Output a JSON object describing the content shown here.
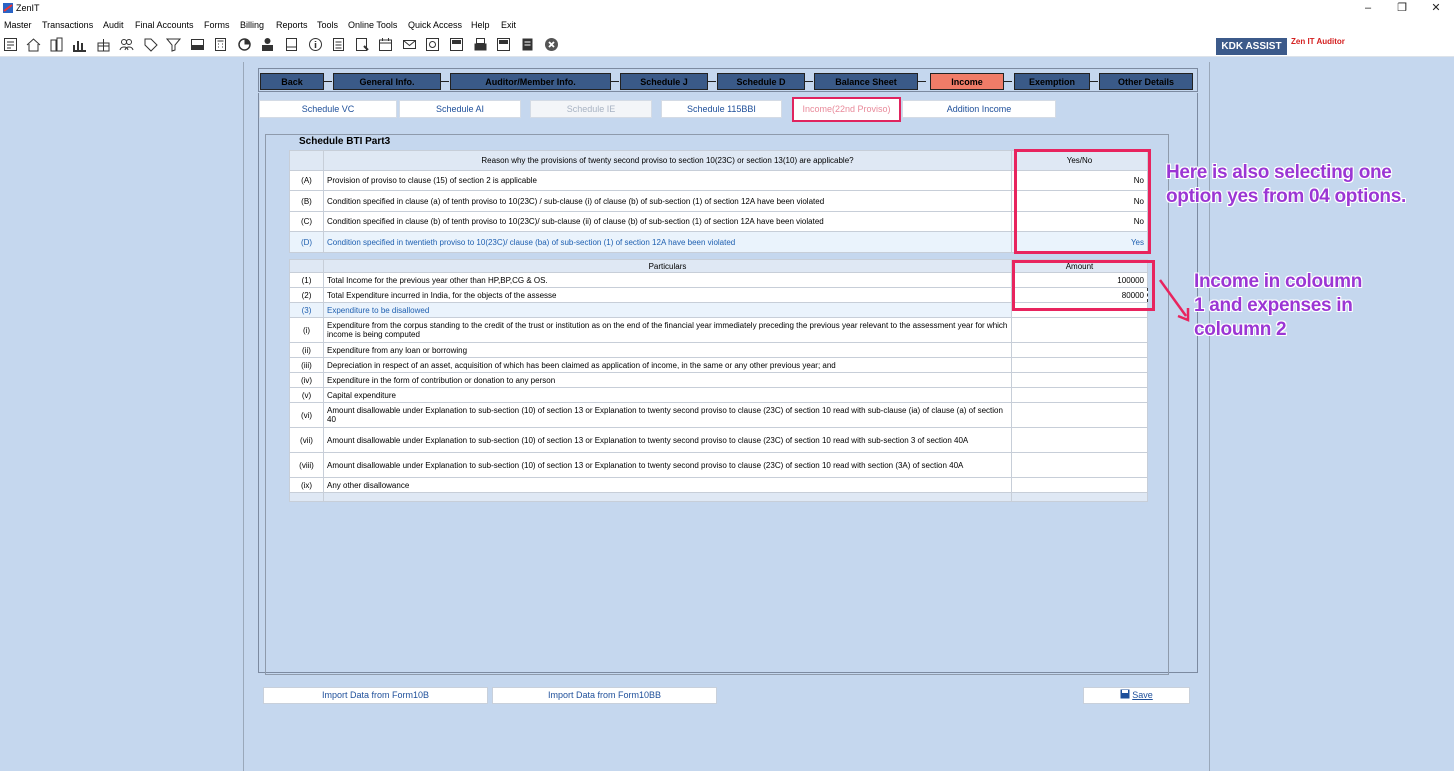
{
  "app": {
    "title": "ZenIT"
  },
  "window_controls": {
    "minimize": "–",
    "restore": "❐",
    "close": "✕"
  },
  "menu": [
    "Master",
    "Transactions",
    "Audit",
    "Final Accounts",
    "Forms",
    "Billing",
    "Reports",
    "Tools",
    "Online Tools",
    "Quick Access",
    "Help",
    "Exit"
  ],
  "toolbar": {
    "icons": [
      "receipt-icon",
      "home-icon",
      "building-icon",
      "bar-chart-icon",
      "gift-icon",
      "users-icon",
      "tag-icon",
      "filter-icon",
      "tax-icon",
      "calculator-icon",
      "pie-icon",
      "user-rupee-icon",
      "document-icon",
      "info-icon",
      "ledger-icon",
      "chart-doc-icon",
      "calendar-icon",
      "mail-icon",
      "refresh-icon",
      "bs-icon",
      "printer-icon",
      "3cd-icon",
      "report-icon",
      "close-circle-icon"
    ],
    "kdk_assist": "KDK ASSIST",
    "zen_auditor": "Zen IT Auditor"
  },
  "tabs": [
    "Back",
    "General Info.",
    "Auditor/Member Info.",
    "Schedule J",
    "Schedule D",
    "Balance Sheet",
    "Income",
    "Exemption",
    "Other Details"
  ],
  "active_tab": "Income",
  "subtabs": [
    "Schedule VC",
    "Schedule AI",
    "Schedule IE",
    "Schedule 115BBI",
    "Income(22nd Proviso)",
    "Addition Income"
  ],
  "schedule_title": "Schedule  BTI Part3",
  "reasons": {
    "header": "Reason why the provisions of twenty second proviso to section 10(23C) or section 13(10) are applicable?",
    "yn_header": "Yes/No",
    "rows": [
      {
        "num": "(A)",
        "text": "Provision of proviso to clause (15) of section 2 is applicable",
        "value": "No"
      },
      {
        "num": "(B)",
        "text": "Condition specified in clause (a) of tenth proviso to 10(23C) / sub-clause (i) of clause (b) of sub-section (1) of section 12A have been violated",
        "value": "No"
      },
      {
        "num": "(C)",
        "text": "Condition specified in clause (b) of tenth proviso to 10(23C)/  sub-clause (ii) of clause (b) of sub-section (1) of section 12A  have been violated",
        "value": "No"
      },
      {
        "num": "(D)",
        "text": "Condition specified in twentieth proviso to 10(23C)/ clause (ba) of sub-section (1) of section 12A have been violated",
        "value": "Yes"
      }
    ]
  },
  "particulars": {
    "header": "Particulars",
    "amount_header": "Amount",
    "rows": [
      {
        "num": "(1)",
        "text": "Total Income for the previous year other than HP,BP,CG & OS.",
        "value": "100000"
      },
      {
        "num": "(2)",
        "text": "Total Expenditure incurred in India, for the objects of the assesse",
        "value": "80000"
      },
      {
        "num": "(3)",
        "text": "Expenditure to be disallowed",
        "value": ""
      },
      {
        "num": "(i)",
        "text": "Expenditure from the corpus standing to the credit of the trust or institution as on the end of the financial year immediately preceding the previous year relevant to the assessment year for which income is being computed",
        "value": ""
      },
      {
        "num": "(ii)",
        "text": "Expenditure from any loan or borrowing",
        "value": ""
      },
      {
        "num": "(iii)",
        "text": "Depreciation in respect of an asset, acquisition of which has been claimed as application of income, in the same or any other previous year; and",
        "value": ""
      },
      {
        "num": "(iv)",
        "text": "Expenditure in the form of contribution or donation to any person",
        "value": ""
      },
      {
        "num": "(v)",
        "text": "Capital expenditure",
        "value": ""
      },
      {
        "num": "(vi)",
        "text": "Amount disallowable under Explanation to sub-section (10) of section 13 or Explanation to twenty second proviso to clause (23C) of section 10 read with sub-clause (ia) of clause (a) of section 40",
        "value": ""
      },
      {
        "num": "(vii)",
        "text": "Amount disallowable under  Explanation to sub-section (10) of section 13 or Explanation to twenty second proviso to clause (23C) of section 10 read with sub-section 3 of section 40A",
        "value": ""
      },
      {
        "num": "(viii)",
        "text": "Amount disallowable under  Explanation to sub-section (10) of section 13 or Explanation to twenty second proviso to clause (23C) of section 10 read with  section (3A) of section 40A",
        "value": ""
      },
      {
        "num": "(ix)",
        "text": "Any other disallowance",
        "value": ""
      }
    ]
  },
  "buttons": {
    "import_10b": "Import Data from Form10B",
    "import_10bb": "Import Data from Form10BB",
    "save": "Save"
  },
  "annotations": {
    "yes_option": "Here is also selecting one option yes from 04 options.",
    "income": "Income in coloumn 1 and expenses in coloumn 2"
  },
  "colors": {
    "tab": "#3a5a88",
    "active_tab": "#f07c68",
    "highlight": "#e8245e",
    "annotation": "#9b36d4",
    "background": "#c5d7ee"
  }
}
